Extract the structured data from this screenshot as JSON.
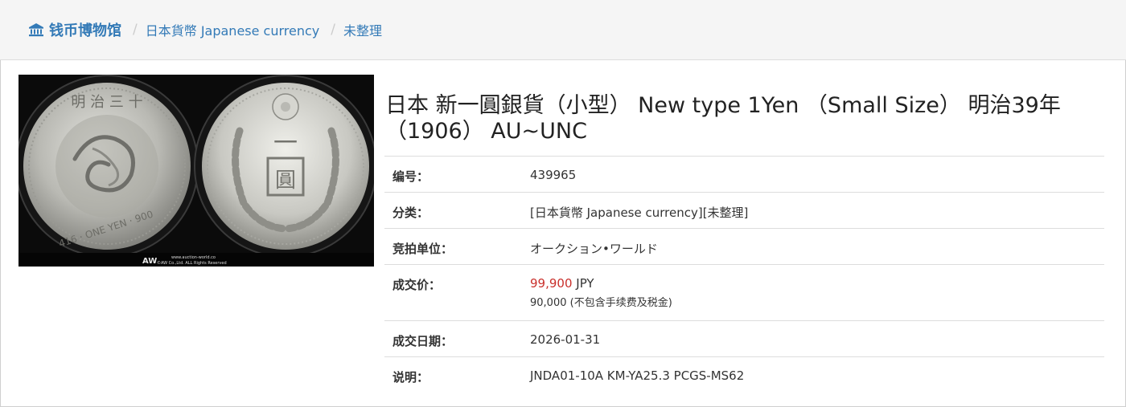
{
  "breadcrumb": {
    "home_label": "钱币博物馆",
    "separator": "/",
    "category_label": "日本貨幣 Japanese currency",
    "subcategory_label": "未整理"
  },
  "coin_image": {
    "watermark_line1": "www.auction-world.co",
    "watermark_line2": "©AW Co.,Ltd. ALL Rights Reserved"
  },
  "title": "日本 新一圓銀貨（小型） New type 1Yen （Small Size） 明治39年（1906） AU~UNC",
  "details": {
    "number_label": "编号：",
    "number_value": "439965",
    "category_label": "分类：",
    "category_value": "[日本貨幣 Japanese currency][未整理]",
    "auction_house_label": "竞拍单位：",
    "auction_house_value": "オークション•ワールド",
    "sale_price_label": "成交价：",
    "sale_price_amount": "99,900",
    "sale_price_currency": "JPY",
    "sale_price_note": "90,000 (不包含手续费及税金)",
    "sale_date_label": "成交日期：",
    "sale_date_value": "2026-01-31",
    "description_label": "说明：",
    "description_value": "JNDA01-10A KM-YA25.3 PCGS-MS62"
  },
  "colors": {
    "link": "#337ab7",
    "price": "#c9302c",
    "breadcrumb_bg": "#f5f5f5"
  }
}
